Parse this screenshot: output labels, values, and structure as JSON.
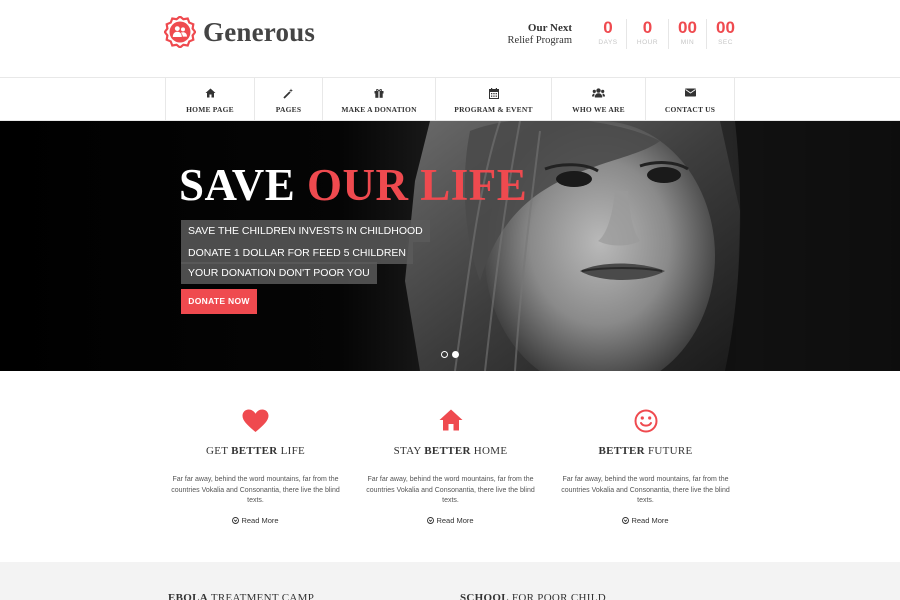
{
  "brand": {
    "name": "Generous",
    "accent": "#ef4a4f"
  },
  "countdown": {
    "label_line1": "Our Next",
    "label_line2": "Relief Program",
    "units": [
      {
        "value": "0",
        "caption": "DAYS"
      },
      {
        "value": "0",
        "caption": "HOUR"
      },
      {
        "value": "00",
        "caption": "MIN"
      },
      {
        "value": "00",
        "caption": "SEC"
      }
    ]
  },
  "nav": {
    "items": [
      {
        "label": "HOME PAGE",
        "icon": "home-icon"
      },
      {
        "label": "PAGES",
        "icon": "magic-wand-icon"
      },
      {
        "label": "MAKE A DONATION",
        "icon": "gift-icon"
      },
      {
        "label": "PROGRAM & EVENT",
        "icon": "calendar-icon"
      },
      {
        "label": "WHO WE ARE",
        "icon": "users-icon"
      },
      {
        "label": "CONTACT US",
        "icon": "envelope-icon"
      }
    ]
  },
  "hero": {
    "title_main": "SAVE",
    "title_accent": "OUR LIFE",
    "taglines": [
      "SAVE THE CHILDREN INVESTS IN CHILDHOOD",
      "DONATE 1 DOLLAR FOR FEED 5 CHILDREN",
      "YOUR DONATION DON'T POOR YOU"
    ],
    "cta": "DONATE NOW",
    "slides": 2,
    "active_slide": 2
  },
  "features": [
    {
      "title_pre": "GET ",
      "title_bold": "BETTER",
      "title_post": " LIFE",
      "icon": "heart-icon",
      "text": "Far far away, behind the word mountains, far from the countries Vokalia and Consonantia, there live the blind texts.",
      "more": "Read More"
    },
    {
      "title_pre": "STAY ",
      "title_bold": "BETTER",
      "title_post": " HOME",
      "icon": "home-icon",
      "text": "Far far away, behind the word mountains, far from the countries Vokalia and Consonantia, there live the blind texts.",
      "more": "Read More"
    },
    {
      "title_pre": "",
      "title_bold": "BETTER",
      "title_post": " FUTURE",
      "icon": "smile-icon",
      "text": "Far far away, behind the word mountains, far from the countries Vokalia and Consonantia, there live the blind texts.",
      "more": "Read More"
    }
  ],
  "bottom": {
    "left": {
      "bold": "EBOLA",
      "rest": " TREATMENT CAMP"
    },
    "right": {
      "bold": "SCHOOL",
      "rest": " FOR POOR CHILD"
    }
  }
}
